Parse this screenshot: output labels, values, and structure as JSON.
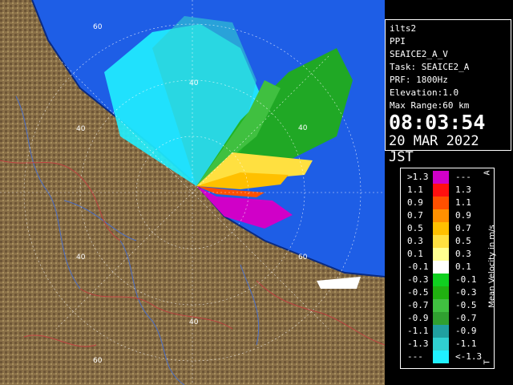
{
  "station": {
    "name": "ilts2",
    "product": "PPI",
    "scan": "SEAICE2_A_V",
    "task": "Task: SEAICE2_A",
    "prf": "PRF: 1800Hz",
    "elevation": "Elevation:1.0",
    "max_range": "Max Range:60 km",
    "time": "08:03:54",
    "date": "20 MAR 2022 JST"
  },
  "range_labels": {
    "n60": "60",
    "ne40": "40",
    "nw40": "40",
    "e40": "40",
    "sw40": "40",
    "s40": "40",
    "sw60": "60",
    "se60": "60"
  },
  "legend": {
    "title": "Mean Velocity in m/s",
    "side_top": "A",
    "side_bottom": "T",
    "rows": [
      {
        "lo": ">1.3",
        "hi": "---",
        "color": "#d000c8"
      },
      {
        "lo": "1.1",
        "hi": "1.3",
        "color": "#ff1010"
      },
      {
        "lo": "0.9",
        "hi": "1.1",
        "color": "#ff5000"
      },
      {
        "lo": "0.7",
        "hi": "0.9",
        "color": "#ff9000"
      },
      {
        "lo": "0.5",
        "hi": "0.7",
        "color": "#ffc000"
      },
      {
        "lo": "0.3",
        "hi": "0.5",
        "color": "#ffe040"
      },
      {
        "lo": "0.1",
        "hi": "0.3",
        "color": "#ffff90"
      },
      {
        "lo": "-0.1",
        "hi": "0.1",
        "color": "#ffffff"
      },
      {
        "lo": "-0.3",
        "hi": "-0.1",
        "color": "#10d020"
      },
      {
        "lo": "-0.5",
        "hi": "-0.3",
        "color": "#20b010"
      },
      {
        "lo": "-0.7",
        "hi": "-0.5",
        "color": "#40c040"
      },
      {
        "lo": "-0.9",
        "hi": "-0.7",
        "color": "#30a030"
      },
      {
        "lo": "-1.1",
        "hi": "-0.9",
        "color": "#20a0a0"
      },
      {
        "lo": "-1.3",
        "hi": "-1.1",
        "color": "#30d0d0"
      },
      {
        "lo": "---",
        "hi": "<-1.3",
        "color": "#20f0ff"
      }
    ]
  },
  "colors": {
    "sea": "#1e5ee6",
    "land": "#8a7048",
    "range_ring": "#ffffff",
    "river": "#4a6ec8",
    "boundary": "#c04040",
    "coast": "#0a2a80"
  }
}
